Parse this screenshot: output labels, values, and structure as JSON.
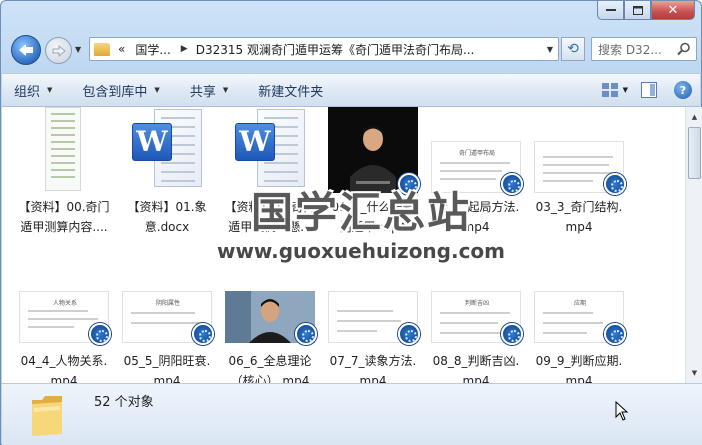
{
  "address": {
    "prefix": "«",
    "crumbs": [
      "国学...",
      "D32315 观澜奇门遁甲运筹《奇门遁甲法奇门布局..."
    ]
  },
  "search": {
    "placeholder": "搜索 D32..."
  },
  "toolbar": {
    "organize": "组织",
    "include_library": "包含到库中",
    "share": "共享",
    "new_folder": "新建文件夹"
  },
  "files": [
    {
      "label_lines": [
        "【资料】00.奇门",
        "遁甲测算内容...."
      ],
      "kind": "document"
    },
    {
      "label_lines": [
        "【资料】01.象",
        "意.docx"
      ],
      "kind": "word"
    },
    {
      "label_lines": [
        "【资料】02.奇门",
        "遁甲案例（懸..."
      ],
      "kind": "word"
    },
    {
      "label_lines": [
        "01_1_什么是奇",
        "门遁甲.mp4"
      ],
      "kind": "video-person"
    },
    {
      "label_lines": [
        "02_2_起局方法.",
        "mp4"
      ],
      "kind": "video-slide",
      "slide_title": "奇门遁甲布局"
    },
    {
      "label_lines": [
        "03_3_奇门结构.",
        "mp4"
      ],
      "kind": "video-slide",
      "slide_title": ""
    },
    {
      "label_lines": [
        "04_4_人物关系.",
        "mp4"
      ],
      "kind": "video-slide",
      "slide_title": "人物关系"
    },
    {
      "label_lines": [
        "05_5_阴阳旺衰.",
        "mp4"
      ],
      "kind": "video-slide",
      "slide_title": "阴阳属性"
    },
    {
      "label_lines": [
        "06_6_全息理论",
        "（核心）.mp4"
      ],
      "kind": "video-person"
    },
    {
      "label_lines": [
        "07_7_读象方法.",
        "mp4"
      ],
      "kind": "video-slide",
      "slide_title": ""
    },
    {
      "label_lines": [
        "08_8_判断吉凶.",
        "mp4"
      ],
      "kind": "video-slide",
      "slide_title": "判断吉凶"
    },
    {
      "label_lines": [
        "09_9_判断应期.",
        "mp4"
      ],
      "kind": "video-slide",
      "slide_title": "应期"
    }
  ],
  "watermark": {
    "title": "国学汇总站",
    "url": "www.guoxuehuizong.com"
  },
  "status": {
    "count": "52 个对象"
  }
}
